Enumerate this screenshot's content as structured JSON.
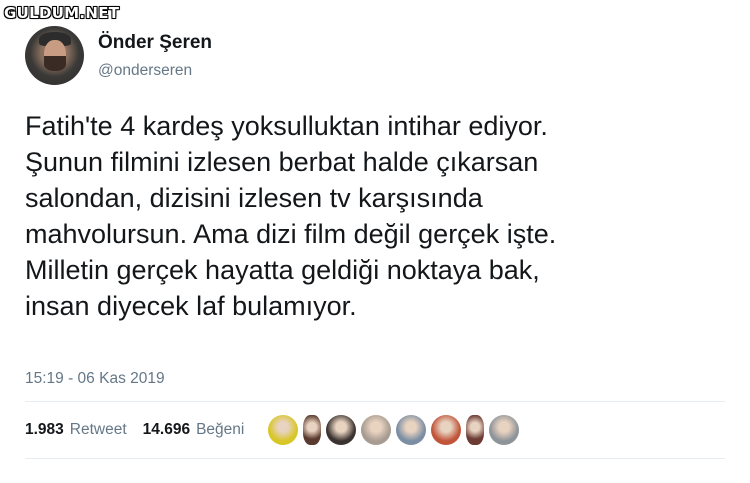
{
  "watermark": "GULDUM.NET",
  "author": {
    "name": "Önder Şeren",
    "handle": "@onderseren"
  },
  "tweet": {
    "text": "Fatih'te 4 kardeş yoksulluktan intihar ediyor.\nŞunun filmini izlesen berbat halde çıkarsan\nsalondan, dizisini izlesen tv karşısında\nmahvolursun. Ama dizi film değil gerçek işte.\nMilletin gerçek hayatta geldiği noktaya bak,\ninsan diyecek laf bulamıyor.",
    "timestamp": "15:19 - 06 Kas 2019"
  },
  "stats": {
    "retweet_count": "1.983",
    "retweet_label": "Retweet",
    "like_count": "14.696",
    "like_label": "Beğeni"
  },
  "likers": [
    {
      "icon": "liker-avatar-1",
      "color": "#d8c626"
    },
    {
      "icon": "liker-avatar-2",
      "color": "#5a3a2e"
    },
    {
      "icon": "liker-avatar-3",
      "color": "#3b3330"
    },
    {
      "icon": "liker-avatar-4",
      "color": "#a89c92"
    },
    {
      "icon": "liker-avatar-5",
      "color": "#7b8ea3"
    },
    {
      "icon": "liker-avatar-6",
      "color": "#c0553a"
    },
    {
      "icon": "liker-avatar-7",
      "color": "#6b3b34"
    },
    {
      "icon": "liker-avatar-8",
      "color": "#8e9499"
    }
  ]
}
